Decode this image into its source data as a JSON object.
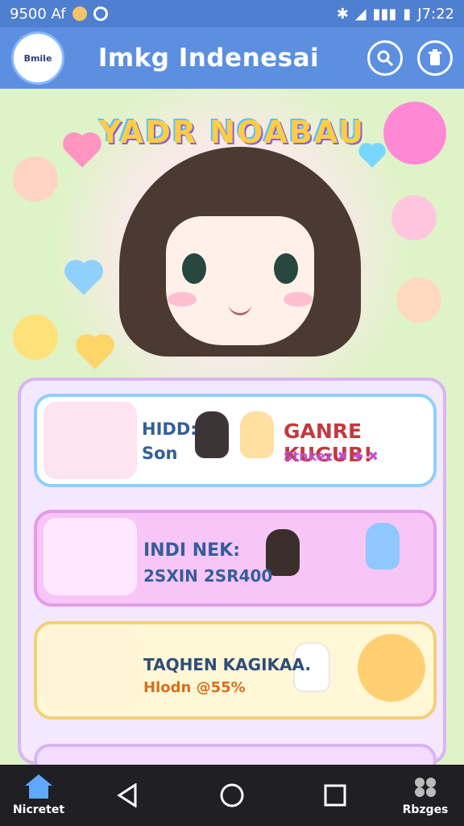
{
  "status": {
    "left_text": "9500 Af",
    "time": "J7:22"
  },
  "app": {
    "title": "Imkg Indenesai",
    "logo_text": "Bmile"
  },
  "hero": {
    "title": "YADR NOABAU"
  },
  "cards": [
    {
      "primary": "HIDD:",
      "secondary": "Son",
      "headline": "GANRE KUGUB!",
      "tagline": "Stnkez ✖ ✚ ✖"
    },
    {
      "primary": "INDI NEK:",
      "secondary": "2SXIN 2SR400"
    },
    {
      "primary": "TAQHEN KAGIKAA.",
      "secondary": "Hlodn @55%"
    }
  ],
  "nav": {
    "left": "Nicretet",
    "right": "Rbzges"
  },
  "colors": {
    "appbar": "#5d8fe1",
    "statusbar": "#4f7fcf",
    "hero_pink": "#ffd8f4",
    "nav": "#1f1f24"
  }
}
